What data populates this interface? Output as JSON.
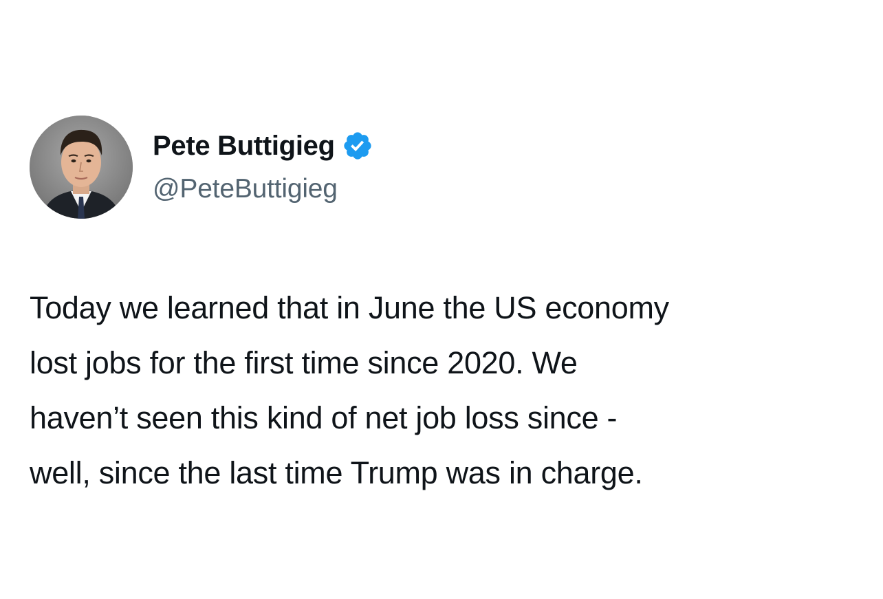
{
  "author": {
    "display_name": "Pete Buttigieg",
    "handle": "@PeteButtigieg",
    "verified": true,
    "verified_badge_color": "#1d9bf0",
    "avatar_icon": "profile-photo"
  },
  "tweet": {
    "lines": [
      "Today we learned that in June the US economy",
      "lost jobs for the first time since 2020. We",
      "haven’t seen this kind of net job loss since -",
      "well, since the last time Trump was in charge."
    ]
  },
  "colors": {
    "text_primary": "#0f1419",
    "text_secondary": "#536471",
    "background": "#ffffff"
  }
}
